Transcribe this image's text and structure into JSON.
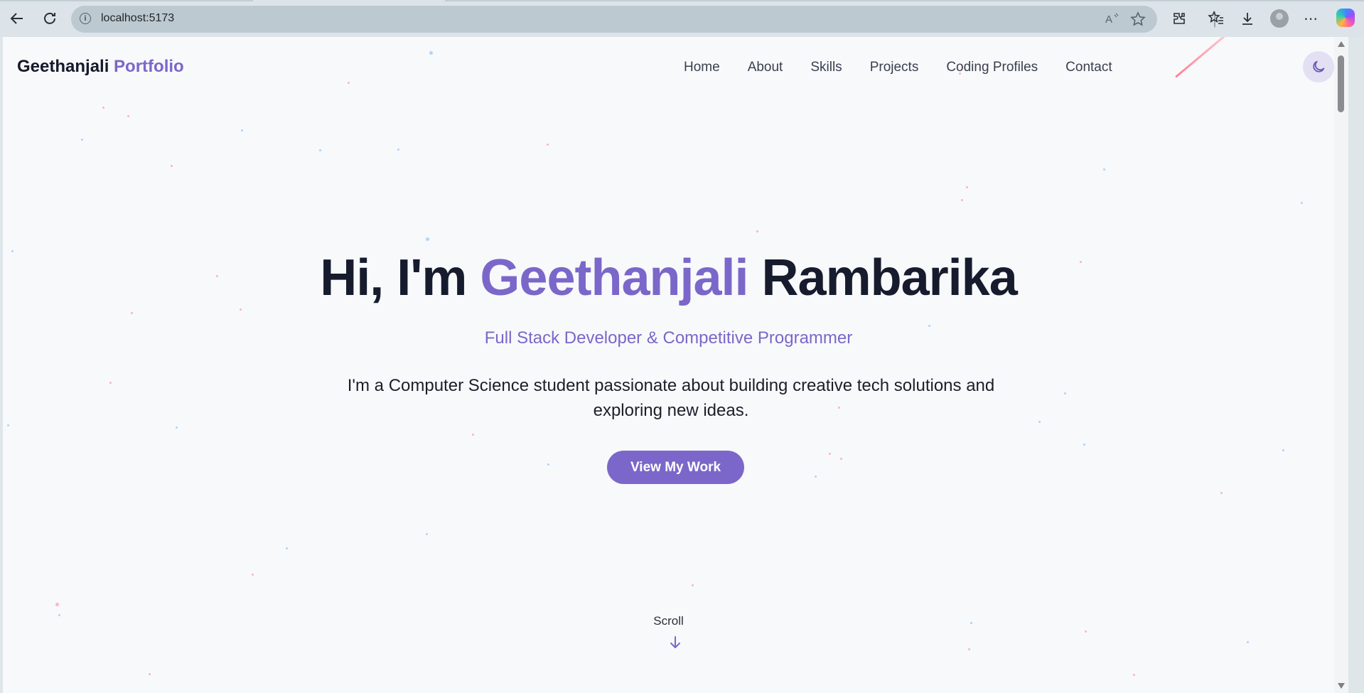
{
  "browser": {
    "url": "localhost:5173",
    "icons": [
      "back-icon",
      "refresh-icon",
      "site-info-icon",
      "read-aloud-icon",
      "favorite-star-icon",
      "extensions-icon",
      "favorites-icon",
      "downloads-icon",
      "profile-icon",
      "more-icon",
      "copilot-icon"
    ]
  },
  "brand": {
    "first": "Geethanjali",
    "second": "Portfolio"
  },
  "nav": {
    "items": [
      "Home",
      "About",
      "Skills",
      "Projects",
      "Coding Profiles",
      "Contact"
    ]
  },
  "theme_toggle": {
    "icon": "moon-icon"
  },
  "hero": {
    "greeting": "Hi, I'm",
    "first_name": "Geethanjali",
    "last_name": "Rambarika",
    "subtitle": "Full Stack Developer & Competitive Programmer",
    "description_line1": "I'm a Computer Science student passionate about building creative tech solutions and",
    "description_line2": "exploring new ideas.",
    "cta_label": "View My Work",
    "scroll_label": "Scroll"
  },
  "colors": {
    "accent": "#7b67c9",
    "text": "#161b2d",
    "background": "#f8f9fb"
  }
}
